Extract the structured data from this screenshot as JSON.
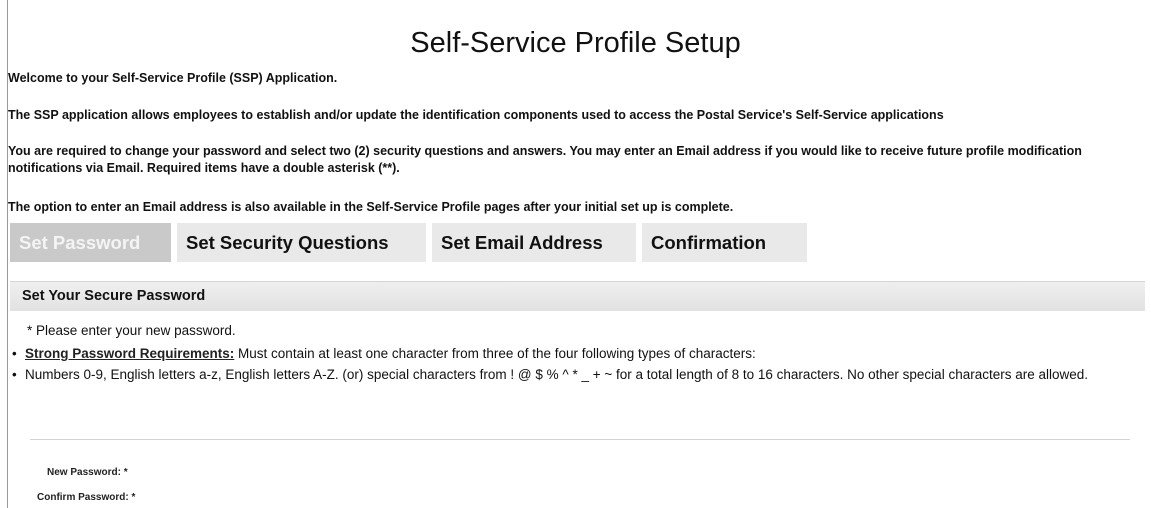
{
  "page": {
    "title": "Self-Service Profile Setup"
  },
  "intro": {
    "welcome": "Welcome to your Self-Service Profile (SSP) Application.",
    "description": "The SSP application allows employees to establish and/or update the identification components used to access the Postal Service's Self-Service applications",
    "requirement": "You are required to change your password and select two (2) security questions and answers. You may enter an Email address if you would like to receive future profile modification notifications via Email. Required items have a double asterisk (**).",
    "email_option": "The option to enter an Email address is also available in the Self-Service Profile pages after your initial set up is complete."
  },
  "tabs": [
    {
      "label": "Set Password",
      "active": true
    },
    {
      "label": "Set Security Questions",
      "active": false
    },
    {
      "label": "Set Email Address",
      "active": false
    },
    {
      "label": "Confirmation",
      "active": false
    }
  ],
  "section": {
    "header": "Set Your Secure Password",
    "instruction": "* Please enter your new password.",
    "bullet_marker": "•",
    "requirements_link": "Strong Password Requirements:",
    "requirements_text": " Must contain at least one character from three of the four following types of characters:",
    "characters_text": "Numbers 0-9, English letters a-z, English letters A-Z. (or) special characters from ! @ $ % ^ * _ + ~ for a total length of 8 to 16 characters. No other special characters are allowed."
  },
  "form": {
    "new_password_label": "New Password: *",
    "confirm_password_label": "Confirm Password: *"
  }
}
